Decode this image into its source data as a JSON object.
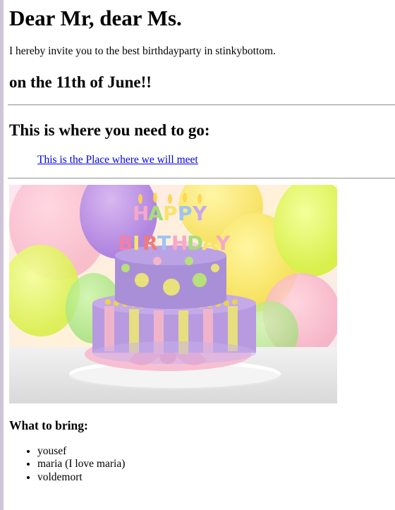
{
  "heading": "Dear Mr, dear Ms.",
  "invitation": "I hereby invite you to the best birthdayparty in stinkybottom.",
  "date_line": "on the 11th of June!!",
  "where_heading": "This is where you need to go:",
  "place_link": "This is the Place where we will meet",
  "image": {
    "description_icon": "birthday-cake-icon",
    "candle_text_top": "HAPPY",
    "candle_text_bottom": "BIRTHDAY"
  },
  "bring": {
    "heading": "What to bring:",
    "items": [
      "yousef",
      "maria (I love maria)",
      "voldemort"
    ]
  },
  "colors": {
    "link": "#0000ee",
    "left_border": "#cfc5d9"
  }
}
